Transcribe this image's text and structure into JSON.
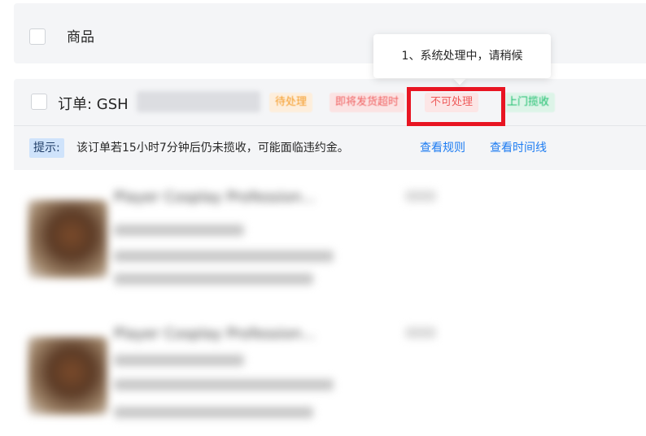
{
  "header": {
    "select_all_label": "商品"
  },
  "order": {
    "order_no": "订单: GSH",
    "tags": {
      "pending": "待处理",
      "timeout": "即将发货超时",
      "blocked": "不可处理",
      "pickup": "上门揽收"
    }
  },
  "tooltip": {
    "text": "1、系统处理中，请稍候"
  },
  "notice": {
    "label": "提示:",
    "text": "该订单若15小时7分钟后仍未揽收，可能面临违约金。",
    "links": {
      "rules": "查看规则",
      "timeline": "查看时间线"
    }
  },
  "products": [
    {
      "title": "Player Cosplay Profession..."
    },
    {
      "title": "Player Cosplay Profession..."
    }
  ],
  "colors": {
    "accent_link": "#1d7cf2",
    "highlight_border": "#e81522",
    "blocked_tag_text": "#ee5a5a",
    "pickup_tag_text": "#19be6b",
    "pending_tag_text": "#f59a23"
  }
}
